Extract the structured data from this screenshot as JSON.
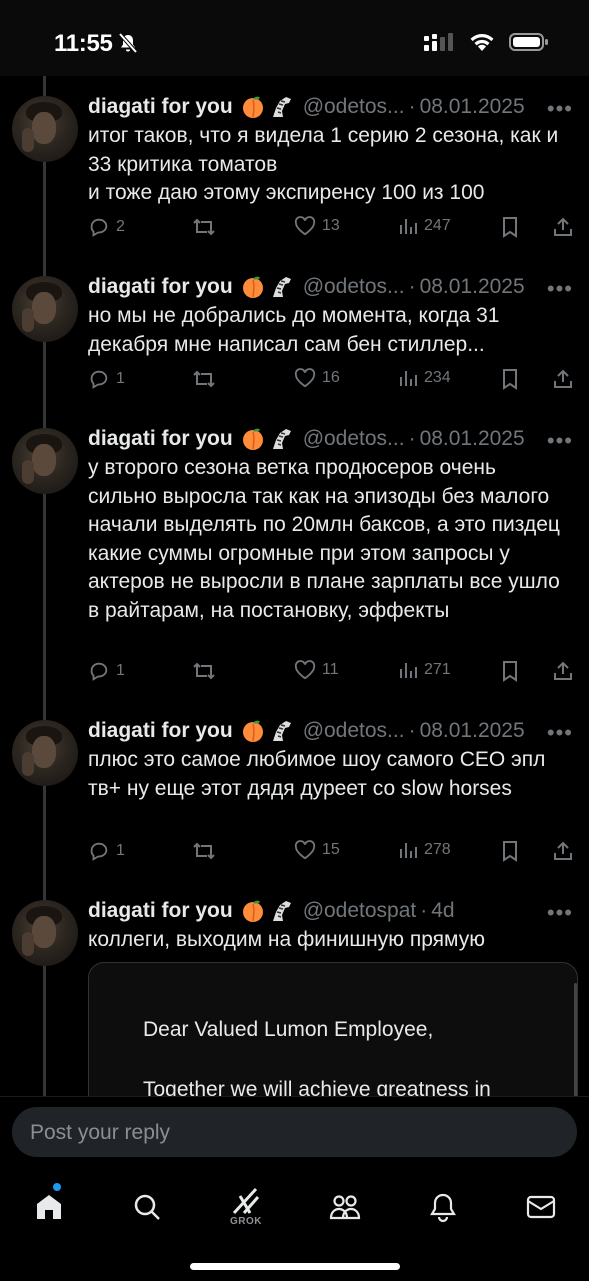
{
  "status_bar": {
    "time": "11:55"
  },
  "tweets": [
    {
      "name": "diagati for you",
      "handle": "@odetos...",
      "dot": "·",
      "date": "08.01.2025",
      "text": "итог таков, что я видела 1 серию 2 сезона, как и 33 критика томатов\nи тоже даю этому экспиренсу 100 из 100",
      "replies": "2",
      "retweets": "",
      "likes": "13",
      "views": "247"
    },
    {
      "name": "diagati for you",
      "handle": "@odetos...",
      "dot": "·",
      "date": "08.01.2025",
      "text": "но мы не добрались до момента, когда 31 декабря мне написал сам бен стиллер...",
      "replies": "1",
      "retweets": "",
      "likes": "16",
      "views": "234"
    },
    {
      "name": "diagati for you",
      "handle": "@odetos...",
      "dot": "·",
      "date": "08.01.2025",
      "text": "у второго сезона ветка продюсеров очень сильно выросла так как на эпизоды без малого начали выделять по 20млн баксов, а это пиздец какие суммы огромные при этом запросы у актеров не выросли в плане зарплаты все ушло в райтарам, на постановку, эффекты",
      "replies": "1",
      "retweets": "",
      "likes": "11",
      "views": "271"
    },
    {
      "name": "diagati for you",
      "handle": "@odetos...",
      "dot": "·",
      "date": "08.01.2025",
      "text": "плюс это самое любимое шоу самого CEO эпл тв+ ну еще этот дядя дуреет со slow horses",
      "replies": "1",
      "retweets": "",
      "likes": "15",
      "views": "278"
    },
    {
      "name": "diagati for you",
      "handle": "@odetospat",
      "dot": "·",
      "date": "4d",
      "text": "коллеги, выходим на финишную прямую"
    }
  ],
  "attached_card": {
    "line1": "Dear Valued Lumon Employee,",
    "line2": "Together we will achieve greatness in"
  },
  "reply": {
    "placeholder": "Post your reply"
  },
  "tabbar": {
    "grok_label": "GROK",
    "items": [
      "home-icon",
      "search-icon",
      "grok-icon",
      "communities-icon",
      "notifications-icon",
      "messages-icon"
    ]
  },
  "colors": {
    "background": "#000000",
    "text": "#e7e9ea",
    "muted": "#71767b",
    "accent": "#1d9bf0"
  }
}
